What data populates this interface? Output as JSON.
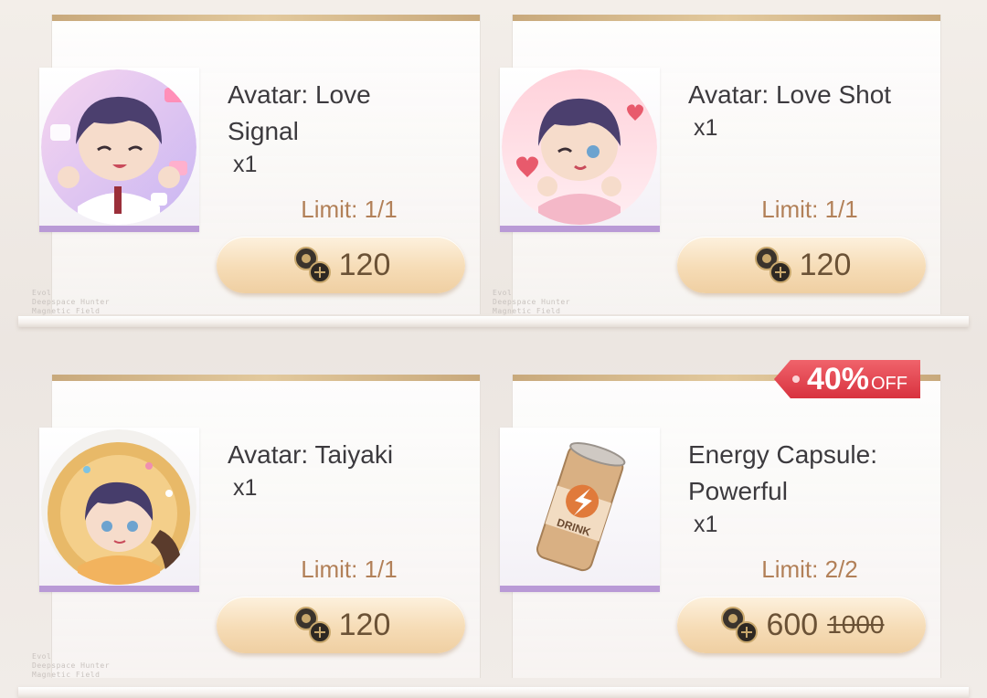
{
  "shop_items": [
    {
      "title_line1": "Avatar: Love",
      "title_line2": "Signal",
      "quantity": "x1",
      "limit": "Limit: 1/1",
      "price": "120",
      "icon": "avatar-love-signal-icon"
    },
    {
      "title_line1": "Avatar: Love Shot",
      "title_line2": "",
      "quantity": "x1",
      "limit": "Limit: 1/1",
      "price": "120",
      "icon": "avatar-love-shot-icon"
    },
    {
      "title_line1": "Avatar: Taiyaki",
      "title_line2": "",
      "quantity": "x1",
      "limit": "Limit: 1/1",
      "price": "120",
      "icon": "avatar-taiyaki-icon"
    },
    {
      "title_line1": "Energy Capsule:",
      "title_line2": "Powerful",
      "quantity": "x1",
      "limit": "Limit: 2/2",
      "price": "600",
      "original_price": "1000",
      "discount_pct": "40%",
      "discount_suffix": "OFF",
      "icon": "energy-drink-can-icon"
    }
  ],
  "decor_text": [
    "Evol",
    "Deepspace Hunter",
    "Magnetic Field"
  ],
  "colors": {
    "gold_bar": "#d7bb8f",
    "limit_text": "#b28058",
    "price_button": "#f6dcb6",
    "discount_badge": "#e04650",
    "frame_stripe": "#b99ad6"
  }
}
